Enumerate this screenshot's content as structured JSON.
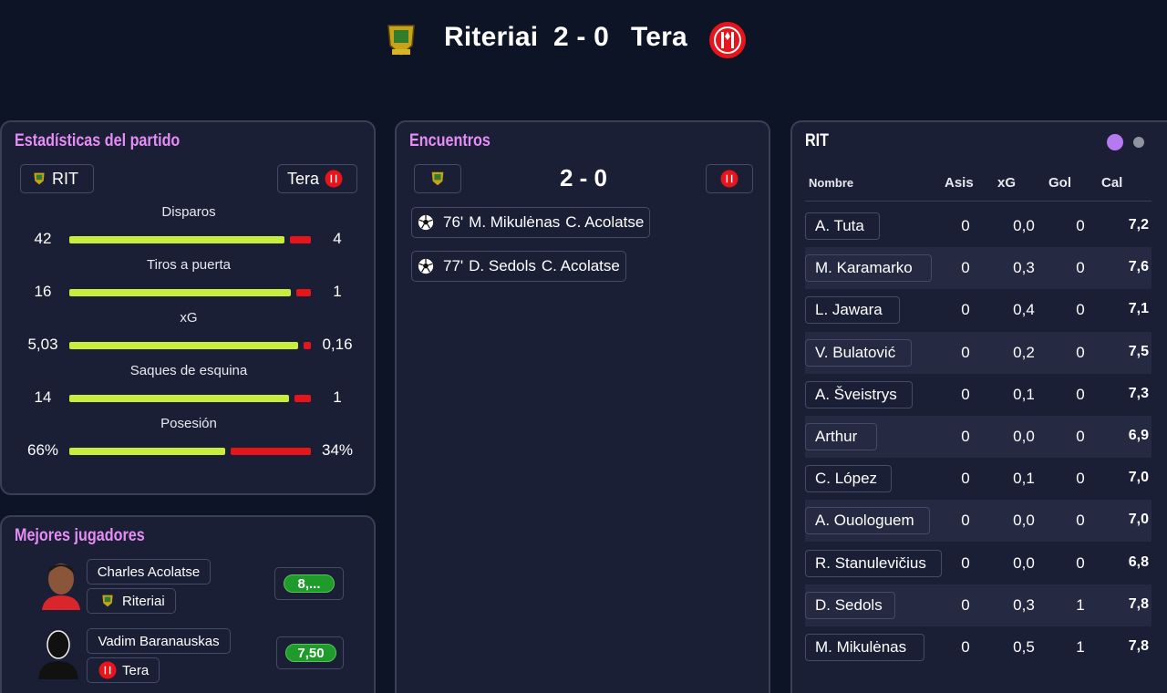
{
  "header": {
    "home_team": "Riteriai",
    "score": "2 - 0",
    "away_team": "Tera",
    "home_crest": "riteriai-crest-icon",
    "away_crest": "tera-crest-icon"
  },
  "stats_panel": {
    "title": "Estadísticas del partido",
    "home_label": "RIT",
    "away_label": "Tera",
    "stats": [
      {
        "label": "Disparos",
        "home": "42",
        "away": "4",
        "home_share": 0.91
      },
      {
        "label": "Tiros a puerta",
        "home": "16",
        "away": "1",
        "home_share": 0.94
      },
      {
        "label": "xG",
        "home": "5,03",
        "away": "0,16",
        "home_share": 0.97
      },
      {
        "label": "Saques de esquina",
        "home": "14",
        "away": "1",
        "home_share": 0.93
      },
      {
        "label": "Posesión",
        "home": "66%",
        "away": "34%",
        "home_share": 0.66
      }
    ]
  },
  "best_players": {
    "title": "Mejores jugadores",
    "players": [
      {
        "name": "Charles Acolatse",
        "team": "Riteriai",
        "rating": "8,..."
      },
      {
        "name": "Vadim Baranauskas",
        "team": "Tera",
        "rating": "7,50"
      }
    ]
  },
  "events_panel": {
    "title": "Encuentros",
    "score": "2 - 0",
    "events": [
      {
        "minute": "76'",
        "scorer": "M. Mikulėnas",
        "assist": "C. Acolatse"
      },
      {
        "minute": "77'",
        "scorer": "D. Sedols",
        "assist": "C. Acolatse"
      }
    ]
  },
  "lineup_panel": {
    "title": "RIT",
    "columns": [
      "Nombre",
      "Asis",
      "xG",
      "Gol",
      "Cal"
    ],
    "rows": [
      {
        "name": "A. Tuta",
        "asis": "0",
        "xg": "0,0",
        "gol": "0",
        "cal": "7,2"
      },
      {
        "name": "M. Karamarko",
        "asis": "0",
        "xg": "0,3",
        "gol": "0",
        "cal": "7,6"
      },
      {
        "name": "L. Jawara",
        "asis": "0",
        "xg": "0,4",
        "gol": "0",
        "cal": "7,1"
      },
      {
        "name": "V. Bulatović",
        "asis": "0",
        "xg": "0,2",
        "gol": "0",
        "cal": "7,5"
      },
      {
        "name": "A. Šveistrys",
        "asis": "0",
        "xg": "0,1",
        "gol": "0",
        "cal": "7,3"
      },
      {
        "name": "Arthur",
        "asis": "0",
        "xg": "0,0",
        "gol": "0",
        "cal": "6,9"
      },
      {
        "name": "C. López",
        "asis": "0",
        "xg": "0,1",
        "gol": "0",
        "cal": "7,0"
      },
      {
        "name": "A. Ouologuem",
        "asis": "0",
        "xg": "0,0",
        "gol": "0",
        "cal": "7,0"
      },
      {
        "name": "R. Stanulevičius",
        "asis": "0",
        "xg": "0,0",
        "gol": "0",
        "cal": "6,8"
      },
      {
        "name": "D. Sedols",
        "asis": "0",
        "xg": "0,3",
        "gol": "1",
        "cal": "7,8"
      },
      {
        "name": "M. Mikulėnas",
        "asis": "0",
        "xg": "0,5",
        "gol": "1",
        "cal": "7,8"
      }
    ],
    "toggle_colors": [
      "#b57af0",
      "#8f949f"
    ]
  },
  "colors": {
    "accent_title": "#e58df5",
    "home_bar": "#c6ee3a",
    "away_bar": "#e8141c",
    "rating_green": "#1e9b2a"
  }
}
